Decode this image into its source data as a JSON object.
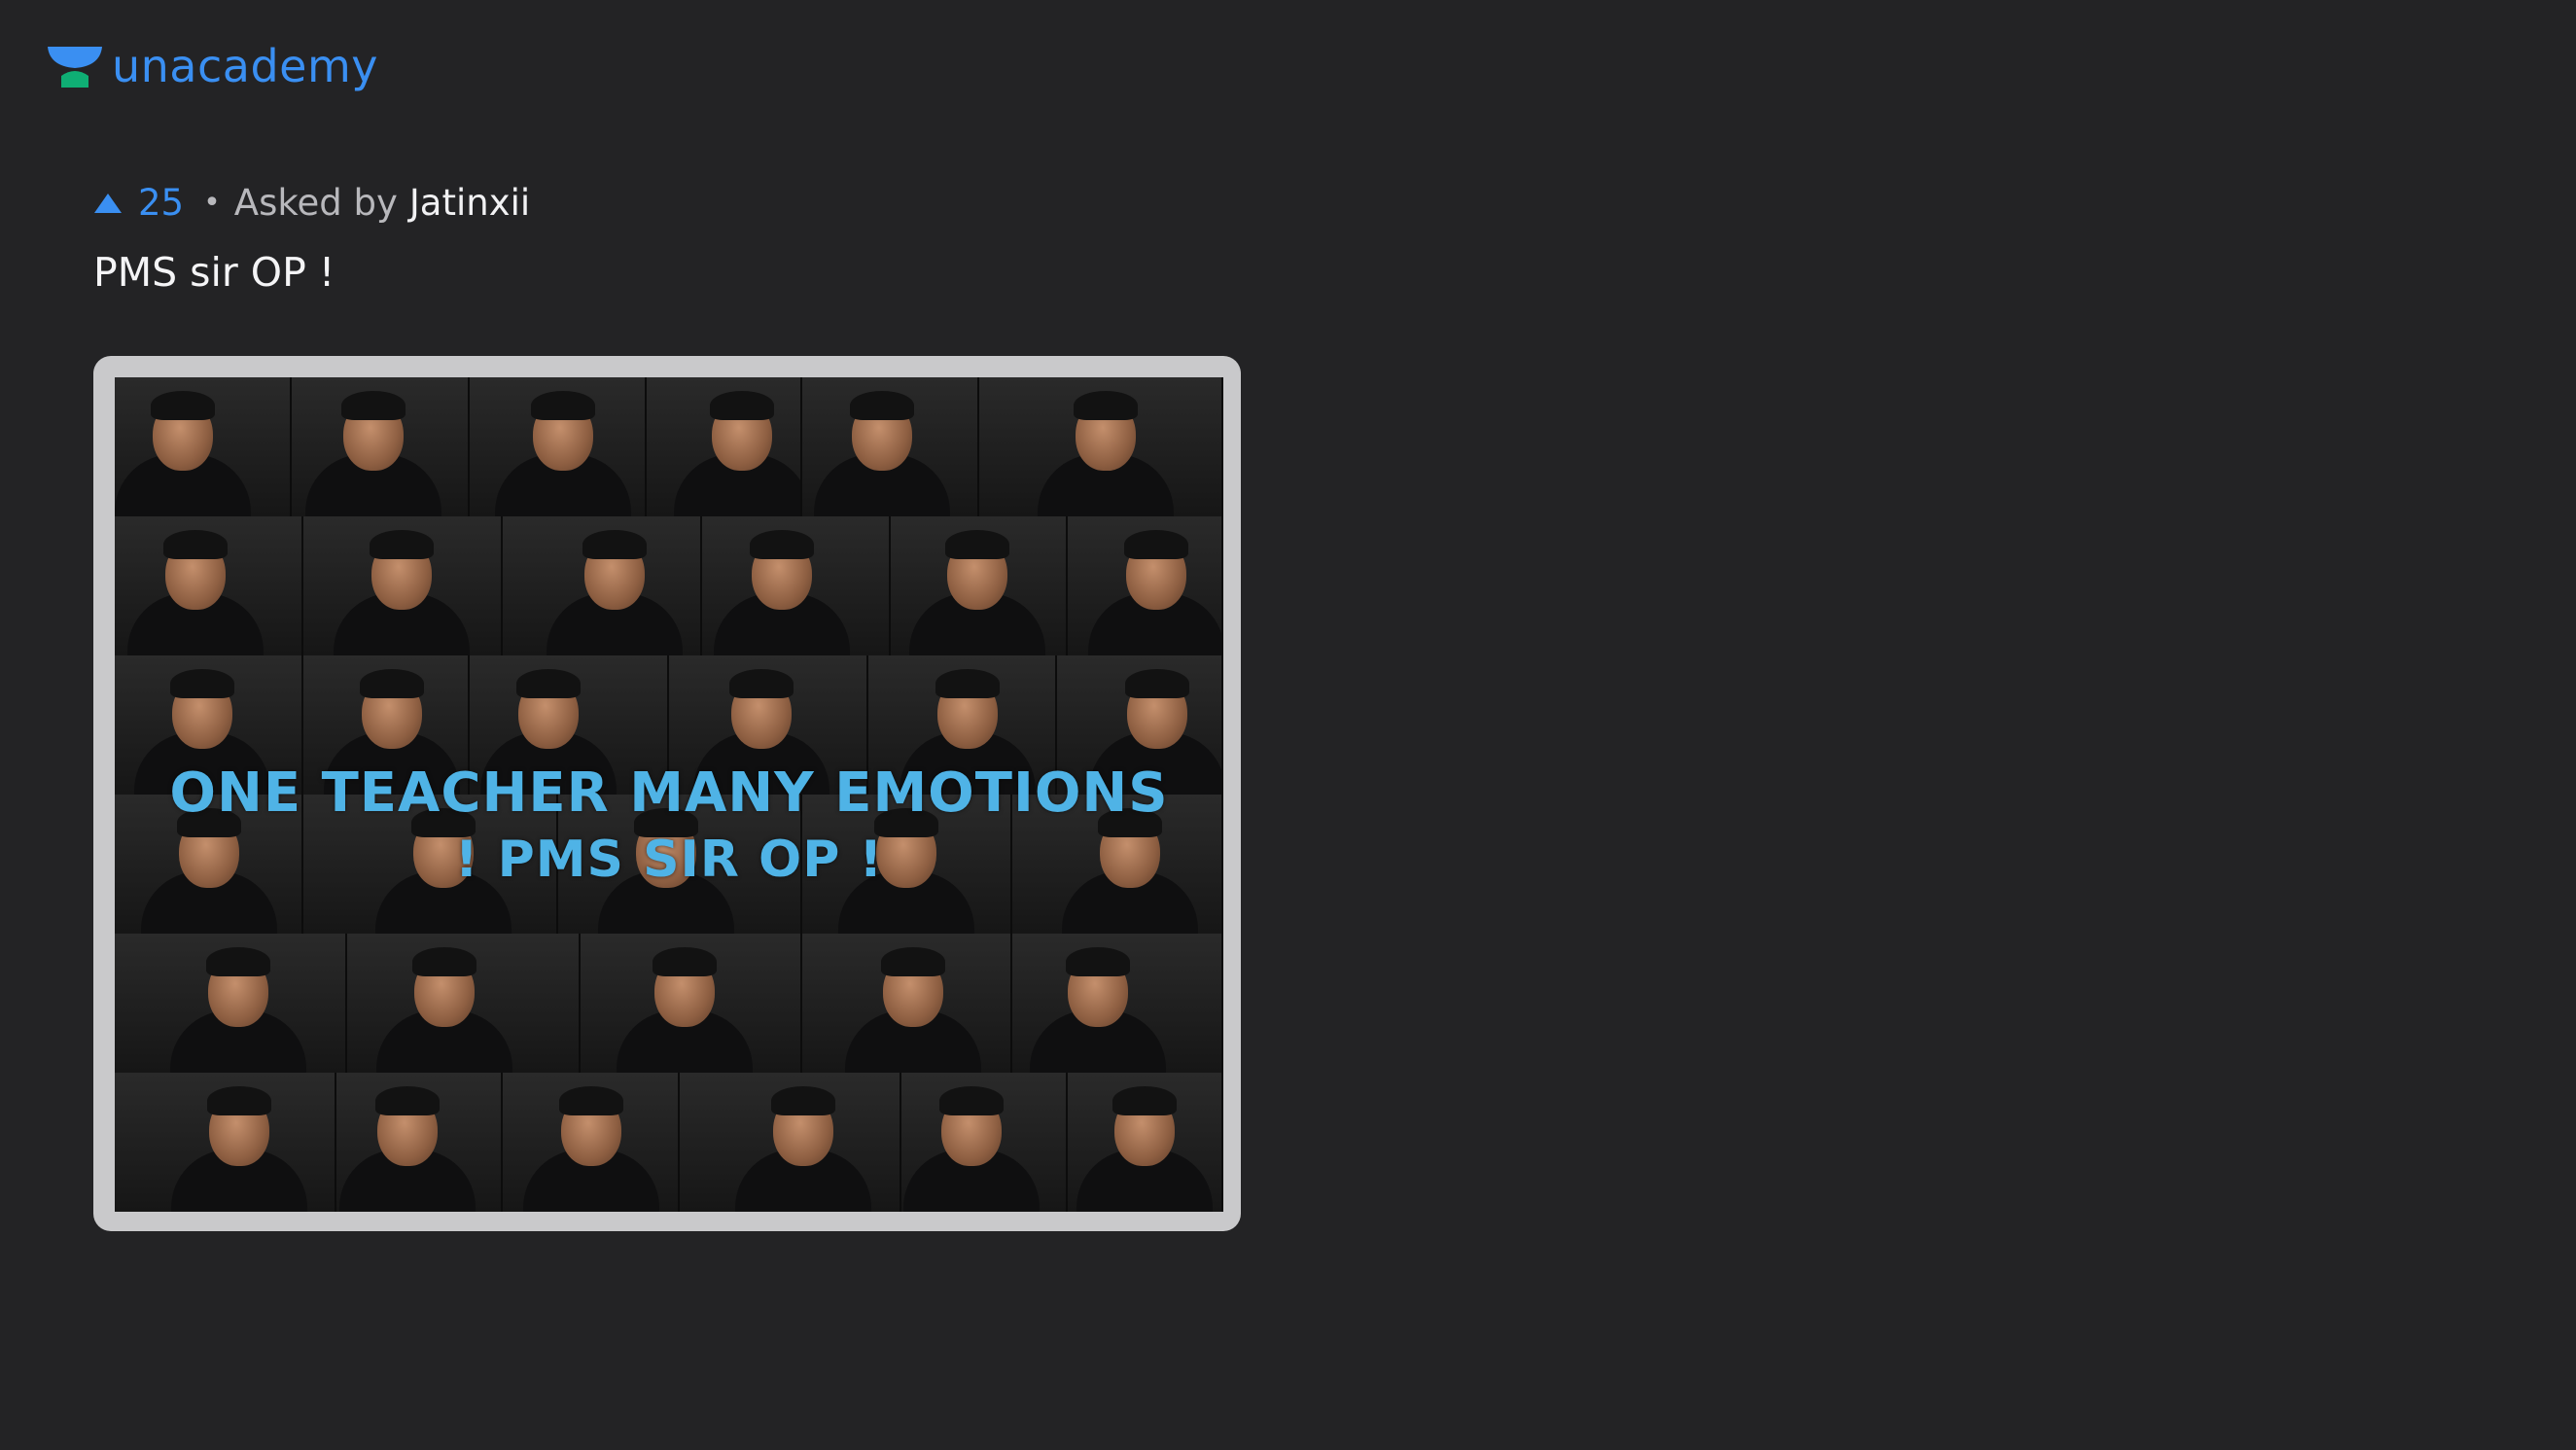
{
  "brand": {
    "name": "unacademy",
    "color": "#3a8ff2",
    "mark_colors": {
      "cap": "#3a8ff2",
      "base": "#0fae74"
    }
  },
  "post": {
    "upvotes": "25",
    "separator": "•",
    "asked_by_label": "Asked by",
    "asker": "Jatinxii",
    "title": "PMS sir OP !"
  },
  "image": {
    "overlay_line_1": "ONE TEACHER MANY EMOTIONS",
    "overlay_line_2": "! PMS SIR OP !",
    "overlay_color": "#4fb3e6"
  },
  "icons": {
    "upvote": "triangle-up-icon",
    "logo": "graduation-cap-icon"
  }
}
